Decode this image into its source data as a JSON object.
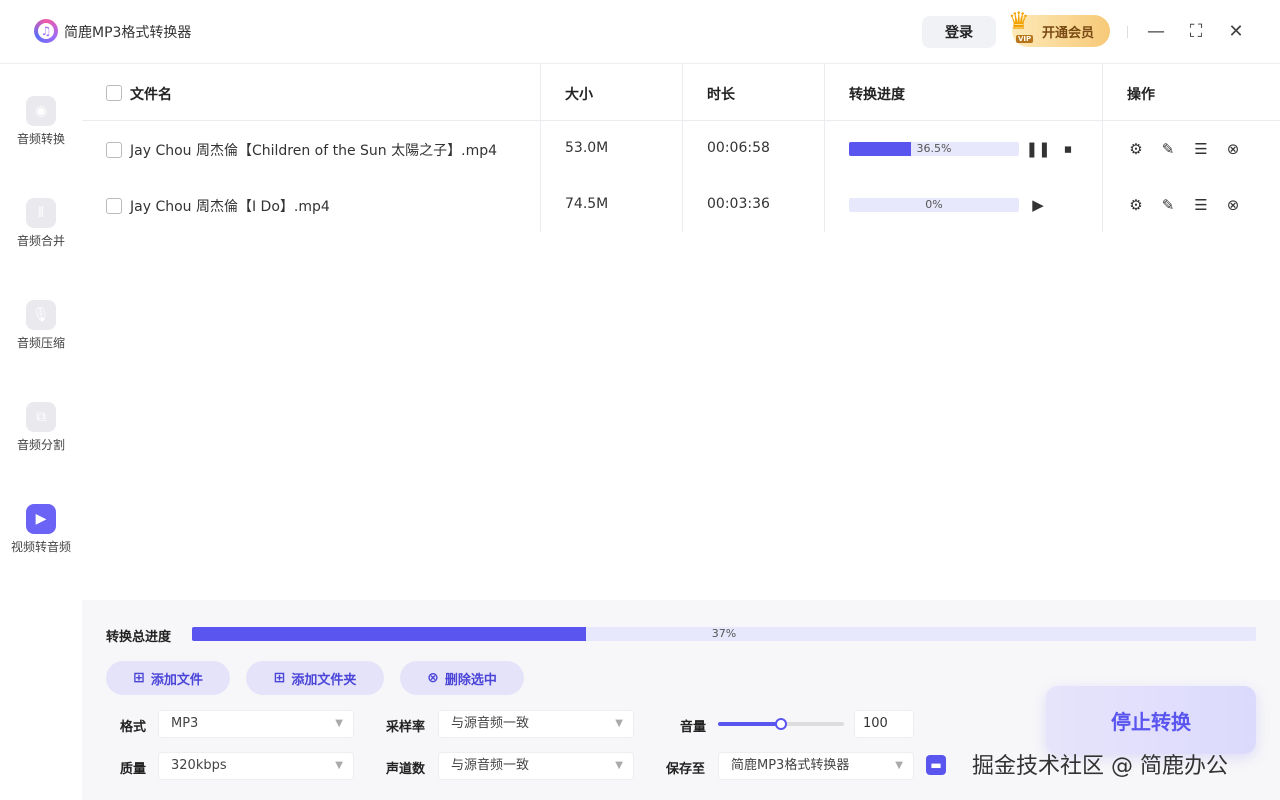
{
  "app": {
    "title": "简鹿MP3格式转换器",
    "login_label": "登录",
    "vip_label": "开通会员",
    "vip_tag": "VIP"
  },
  "window": {
    "minimize": "—",
    "maximize": "⛶",
    "close": "✕"
  },
  "sidebar": {
    "items": [
      {
        "label": "音频转换",
        "icon": "audio-convert-icon",
        "active": false
      },
      {
        "label": "音频合并",
        "icon": "audio-merge-icon",
        "active": false
      },
      {
        "label": "音频压缩",
        "icon": "audio-compress-icon",
        "active": false
      },
      {
        "label": "音频分割",
        "icon": "audio-split-icon",
        "active": false
      },
      {
        "label": "视频转音频",
        "icon": "video-to-audio-icon",
        "active": true
      }
    ]
  },
  "table": {
    "headers": {
      "name": "文件名",
      "size": "大小",
      "duration": "时长",
      "progress": "转换进度",
      "actions": "操作"
    },
    "rows": [
      {
        "name": "Jay Chou 周杰倫【Children of the Sun 太陽之子】.mp4",
        "size": "53.0M",
        "duration": "00:06:58",
        "progress": 36.5,
        "progress_text": "36.5%",
        "state": "converting"
      },
      {
        "name": "Jay Chou 周杰倫【I Do】.mp4",
        "size": "74.5M",
        "duration": "00:03:36",
        "progress": 0,
        "progress_text": "0%",
        "state": "waiting"
      }
    ]
  },
  "bottom": {
    "total_label": "转换总进度",
    "total_progress": 37,
    "total_text": "37%",
    "add_file": "添加文件",
    "add_folder": "添加文件夹",
    "delete_selected": "删除选中",
    "format_label": "格式",
    "format_value": "MP3",
    "quality_label": "质量",
    "quality_value": "320kbps",
    "sample_rate_label": "采样率",
    "sample_rate_value": "与源音频一致",
    "channels_label": "声道数",
    "channels_value": "与源音频一致",
    "volume_label": "音量",
    "volume_value": "100",
    "volume_level": 0.5,
    "save_label": "保存至",
    "save_value": "简鹿MP3格式转换器",
    "stop_label": "停止转换",
    "watermark": "掘金技术社区 @ 简鹿办公"
  },
  "colors": {
    "accent": "#5b55f0",
    "accent_light": "#e8e8fc"
  }
}
